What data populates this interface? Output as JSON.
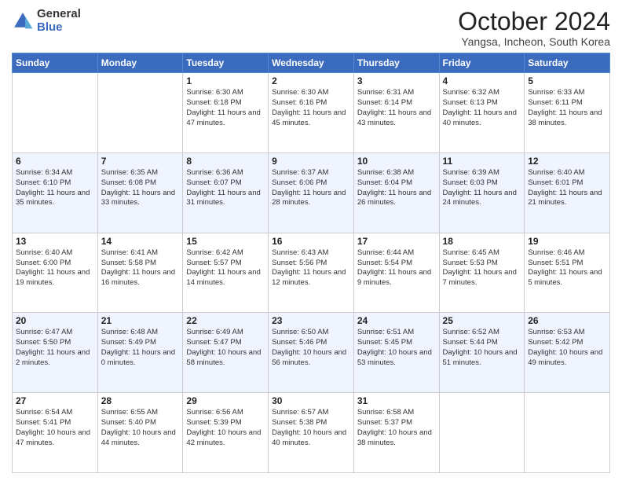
{
  "logo": {
    "general": "General",
    "blue": "Blue"
  },
  "title": "October 2024",
  "location": "Yangsa, Incheon, South Korea",
  "days_of_week": [
    "Sunday",
    "Monday",
    "Tuesday",
    "Wednesday",
    "Thursday",
    "Friday",
    "Saturday"
  ],
  "weeks": [
    [
      {
        "day": "",
        "info": ""
      },
      {
        "day": "",
        "info": ""
      },
      {
        "day": "1",
        "info": "Sunrise: 6:30 AM\nSunset: 6:18 PM\nDaylight: 11 hours and 47 minutes."
      },
      {
        "day": "2",
        "info": "Sunrise: 6:30 AM\nSunset: 6:16 PM\nDaylight: 11 hours and 45 minutes."
      },
      {
        "day": "3",
        "info": "Sunrise: 6:31 AM\nSunset: 6:14 PM\nDaylight: 11 hours and 43 minutes."
      },
      {
        "day": "4",
        "info": "Sunrise: 6:32 AM\nSunset: 6:13 PM\nDaylight: 11 hours and 40 minutes."
      },
      {
        "day": "5",
        "info": "Sunrise: 6:33 AM\nSunset: 6:11 PM\nDaylight: 11 hours and 38 minutes."
      }
    ],
    [
      {
        "day": "6",
        "info": "Sunrise: 6:34 AM\nSunset: 6:10 PM\nDaylight: 11 hours and 35 minutes."
      },
      {
        "day": "7",
        "info": "Sunrise: 6:35 AM\nSunset: 6:08 PM\nDaylight: 11 hours and 33 minutes."
      },
      {
        "day": "8",
        "info": "Sunrise: 6:36 AM\nSunset: 6:07 PM\nDaylight: 11 hours and 31 minutes."
      },
      {
        "day": "9",
        "info": "Sunrise: 6:37 AM\nSunset: 6:06 PM\nDaylight: 11 hours and 28 minutes."
      },
      {
        "day": "10",
        "info": "Sunrise: 6:38 AM\nSunset: 6:04 PM\nDaylight: 11 hours and 26 minutes."
      },
      {
        "day": "11",
        "info": "Sunrise: 6:39 AM\nSunset: 6:03 PM\nDaylight: 11 hours and 24 minutes."
      },
      {
        "day": "12",
        "info": "Sunrise: 6:40 AM\nSunset: 6:01 PM\nDaylight: 11 hours and 21 minutes."
      }
    ],
    [
      {
        "day": "13",
        "info": "Sunrise: 6:40 AM\nSunset: 6:00 PM\nDaylight: 11 hours and 19 minutes."
      },
      {
        "day": "14",
        "info": "Sunrise: 6:41 AM\nSunset: 5:58 PM\nDaylight: 11 hours and 16 minutes."
      },
      {
        "day": "15",
        "info": "Sunrise: 6:42 AM\nSunset: 5:57 PM\nDaylight: 11 hours and 14 minutes."
      },
      {
        "day": "16",
        "info": "Sunrise: 6:43 AM\nSunset: 5:56 PM\nDaylight: 11 hours and 12 minutes."
      },
      {
        "day": "17",
        "info": "Sunrise: 6:44 AM\nSunset: 5:54 PM\nDaylight: 11 hours and 9 minutes."
      },
      {
        "day": "18",
        "info": "Sunrise: 6:45 AM\nSunset: 5:53 PM\nDaylight: 11 hours and 7 minutes."
      },
      {
        "day": "19",
        "info": "Sunrise: 6:46 AM\nSunset: 5:51 PM\nDaylight: 11 hours and 5 minutes."
      }
    ],
    [
      {
        "day": "20",
        "info": "Sunrise: 6:47 AM\nSunset: 5:50 PM\nDaylight: 11 hours and 2 minutes."
      },
      {
        "day": "21",
        "info": "Sunrise: 6:48 AM\nSunset: 5:49 PM\nDaylight: 11 hours and 0 minutes."
      },
      {
        "day": "22",
        "info": "Sunrise: 6:49 AM\nSunset: 5:47 PM\nDaylight: 10 hours and 58 minutes."
      },
      {
        "day": "23",
        "info": "Sunrise: 6:50 AM\nSunset: 5:46 PM\nDaylight: 10 hours and 56 minutes."
      },
      {
        "day": "24",
        "info": "Sunrise: 6:51 AM\nSunset: 5:45 PM\nDaylight: 10 hours and 53 minutes."
      },
      {
        "day": "25",
        "info": "Sunrise: 6:52 AM\nSunset: 5:44 PM\nDaylight: 10 hours and 51 minutes."
      },
      {
        "day": "26",
        "info": "Sunrise: 6:53 AM\nSunset: 5:42 PM\nDaylight: 10 hours and 49 minutes."
      }
    ],
    [
      {
        "day": "27",
        "info": "Sunrise: 6:54 AM\nSunset: 5:41 PM\nDaylight: 10 hours and 47 minutes."
      },
      {
        "day": "28",
        "info": "Sunrise: 6:55 AM\nSunset: 5:40 PM\nDaylight: 10 hours and 44 minutes."
      },
      {
        "day": "29",
        "info": "Sunrise: 6:56 AM\nSunset: 5:39 PM\nDaylight: 10 hours and 42 minutes."
      },
      {
        "day": "30",
        "info": "Sunrise: 6:57 AM\nSunset: 5:38 PM\nDaylight: 10 hours and 40 minutes."
      },
      {
        "day": "31",
        "info": "Sunrise: 6:58 AM\nSunset: 5:37 PM\nDaylight: 10 hours and 38 minutes."
      },
      {
        "day": "",
        "info": ""
      },
      {
        "day": "",
        "info": ""
      }
    ]
  ]
}
